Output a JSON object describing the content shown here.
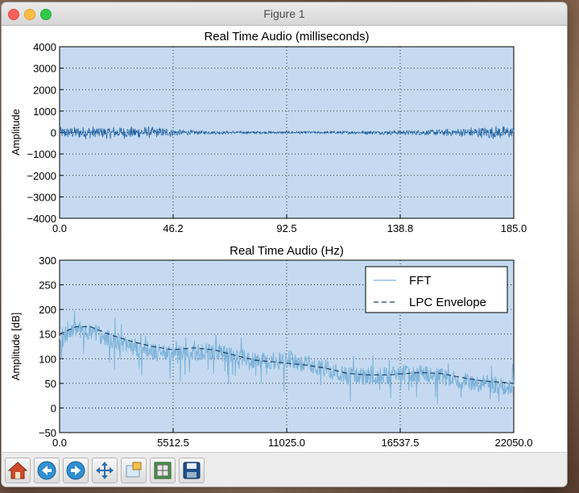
{
  "window": {
    "title": "Figure 1"
  },
  "toolbar": {
    "buttons": [
      {
        "name": "home-button",
        "icon": "home-icon"
      },
      {
        "name": "back-button",
        "icon": "back-arrow-icon"
      },
      {
        "name": "forward-button",
        "icon": "forward-arrow-icon"
      },
      {
        "name": "pan-button",
        "icon": "pan-arrows-icon"
      },
      {
        "name": "zoom-button",
        "icon": "zoom-rect-icon"
      },
      {
        "name": "subplots-button",
        "icon": "subplots-config-icon"
      },
      {
        "name": "save-button",
        "icon": "floppy-disk-icon"
      }
    ]
  },
  "chart_data": [
    {
      "type": "line",
      "title": "Real Time Audio (milliseconds)",
      "xlabel": "",
      "ylabel": "Amplitude",
      "xlim": [
        0.0,
        185.0
      ],
      "ylim": [
        -4000,
        4000
      ],
      "xticks": [
        "0.0",
        "46.2",
        "92.5",
        "138.8",
        "185.0"
      ],
      "yticks": [
        "4000",
        "3000",
        "2000",
        "1000",
        "0",
        "−1000",
        "−2000",
        "−3000",
        "−4000"
      ],
      "grid": true,
      "series": [
        {
          "color": "#1f5fa0",
          "envelope": {
            "x": [
              0,
              10,
              20,
              30,
              40,
              46.2,
              50,
              60,
              80,
              100,
              120,
              140,
              150,
              160,
              170,
              178,
              185
            ],
            "amplitude": [
              280,
              320,
              300,
              300,
              270,
              220,
              140,
              90,
              70,
              70,
              80,
              120,
              150,
              200,
              280,
              330,
              320
            ]
          }
        }
      ]
    },
    {
      "type": "line",
      "title": "Real Time Audio (Hz)",
      "xlabel": "",
      "ylabel": "Amplitude [dB]",
      "xlim": [
        0.0,
        22050.0
      ],
      "ylim": [
        -50,
        300
      ],
      "xticks": [
        "0.0",
        "5512.5",
        "11025.0",
        "16537.5",
        "22050.0"
      ],
      "yticks": [
        "300",
        "250",
        "200",
        "150",
        "100",
        "50",
        "0",
        "−50"
      ],
      "grid": true,
      "legend": "upper-right",
      "series": [
        {
          "name": "FFT",
          "color": "#7fb3d9",
          "x": [
            0,
            300,
            800,
            1500,
            2500,
            3500,
            4500,
            5512.5,
            6500,
            7500,
            8500,
            9500,
            10500,
            11025,
            12000,
            13000,
            14000,
            15000,
            16000,
            16537.5,
            17500,
            18500,
            19500,
            20500,
            21500,
            22050
          ],
          "y": [
            130,
            150,
            160,
            155,
            140,
            125,
            115,
            110,
            112,
            115,
            108,
            95,
            95,
            100,
            90,
            80,
            65,
            65,
            67,
            70,
            70,
            65,
            55,
            50,
            45,
            42
          ]
        },
        {
          "name": "LPC Envelope",
          "color": "#1b3f63",
          "style": "dashed",
          "x": [
            0,
            800,
            1500,
            2500,
            3500,
            4500,
            5512.5,
            6500,
            7500,
            8500,
            9500,
            10500,
            11025,
            12000,
            13000,
            14000,
            15000,
            16000,
            16537.5,
            17500,
            18500,
            19500,
            20500,
            21500,
            22050
          ],
          "y": [
            150,
            165,
            165,
            148,
            135,
            125,
            118,
            122,
            118,
            107,
            97,
            93,
            91,
            87,
            80,
            70,
            67,
            67,
            69,
            72,
            70,
            62,
            55,
            52,
            50
          ]
        }
      ]
    }
  ]
}
